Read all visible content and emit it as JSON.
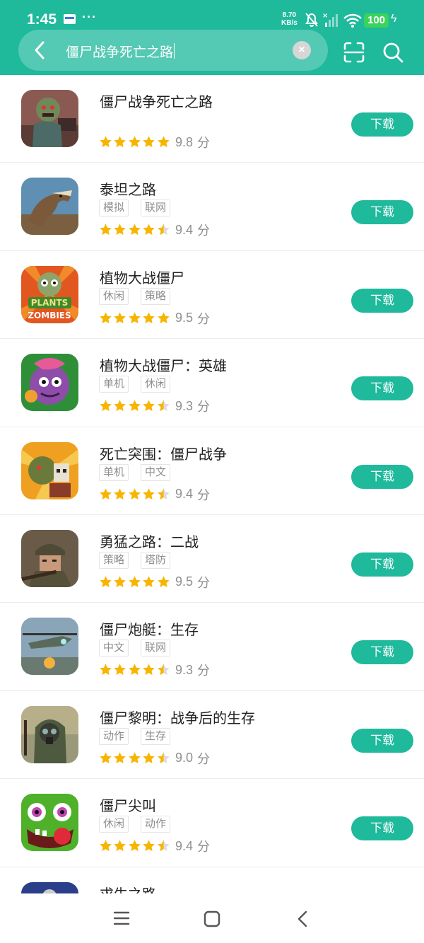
{
  "status": {
    "time": "1:45",
    "more": "···",
    "speed_value": "8.70",
    "speed_unit": "KB/s",
    "battery": "100"
  },
  "search": {
    "query": "僵尸战争死亡之路",
    "clear_label": "×"
  },
  "colors": {
    "accent": "#1fb99c",
    "star": "#f7b500",
    "tag_border": "#e4e4e4"
  },
  "apps": [
    {
      "name": "僵尸战争死亡之路",
      "tags": [],
      "rating": 5,
      "score": "9.8",
      "unit": "分",
      "button": "下载",
      "icon": "zombie-war-icon"
    },
    {
      "name": "泰坦之路",
      "tags": [
        "模拟",
        "联网"
      ],
      "rating": 4.5,
      "score": "9.4",
      "unit": "分",
      "button": "下载",
      "icon": "dinosaur-icon"
    },
    {
      "name": "植物大战僵尸",
      "tags": [
        "休闲",
        "策略"
      ],
      "rating": 5,
      "score": "9.5",
      "unit": "分",
      "button": "下载",
      "icon": "plants-vs-zombies-icon"
    },
    {
      "name": "植物大战僵尸：英雄",
      "tags": [
        "单机",
        "休闲"
      ],
      "rating": 4.5,
      "score": "9.3",
      "unit": "分",
      "button": "下载",
      "icon": "pvz-heroes-icon"
    },
    {
      "name": "死亡突围：僵尸战争",
      "tags": [
        "单机",
        "中文"
      ],
      "rating": 4.5,
      "score": "9.4",
      "unit": "分",
      "button": "下载",
      "icon": "zombie-breakout-icon"
    },
    {
      "name": "勇猛之路：二战",
      "tags": [
        "策略",
        "塔防"
      ],
      "rating": 5,
      "score": "9.5",
      "unit": "分",
      "button": "下载",
      "icon": "soldier-icon"
    },
    {
      "name": "僵尸炮艇：生存",
      "tags": [
        "中文",
        "联网"
      ],
      "rating": 4.5,
      "score": "9.3",
      "unit": "分",
      "button": "下载",
      "icon": "gunship-icon"
    },
    {
      "name": "僵尸黎明：战争后的生存",
      "tags": [
        "动作",
        "生存"
      ],
      "rating": 4.5,
      "score": "9.0",
      "unit": "分",
      "button": "下载",
      "icon": "gas-mask-icon"
    },
    {
      "name": "僵尸尖叫",
      "tags": [
        "休闲",
        "动作"
      ],
      "rating": 4.5,
      "score": "9.4",
      "unit": "分",
      "button": "下载",
      "icon": "green-monster-icon"
    },
    {
      "name": "求生之路",
      "tags": [],
      "rating": 0,
      "score": "",
      "unit": "",
      "button": "",
      "icon": "survival-icon"
    }
  ]
}
